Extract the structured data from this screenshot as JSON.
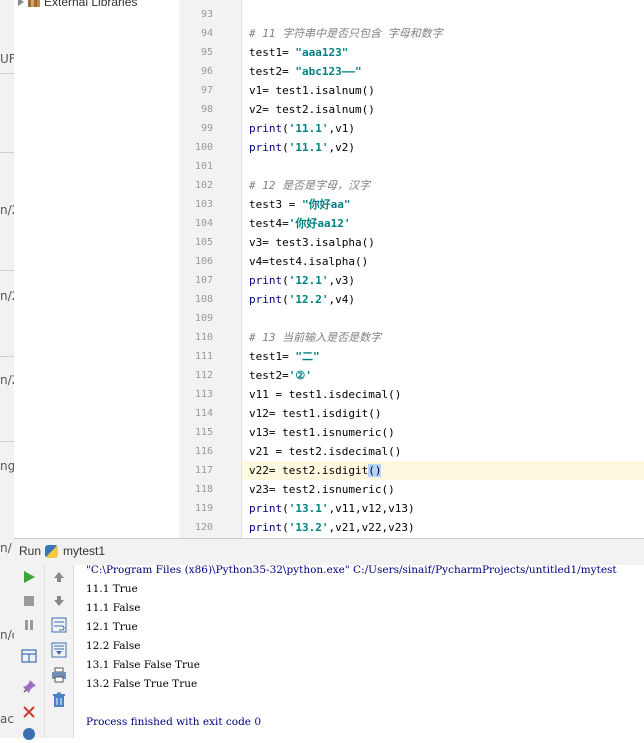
{
  "project": {
    "external_libraries_label": "External Libraries"
  },
  "left_strip": {
    "labels": [
      "UF",
      "n/2",
      "n/2",
      "n/2",
      "ng,",
      "n/",
      "n/c",
      "ac"
    ]
  },
  "editor": {
    "line_numbers": [
      "93",
      "94",
      "95",
      "96",
      "97",
      "98",
      "99",
      "100",
      "101",
      "102",
      "103",
      "104",
      "105",
      "106",
      "107",
      "108",
      "109",
      "110",
      "111",
      "112",
      "113",
      "114",
      "115",
      "116",
      "117",
      "118",
      "119",
      "120"
    ],
    "comments": {
      "c94": "# 11 字符串中是否只包含 字母和数字",
      "c102": "# 12 是否是字母，汉字",
      "c110": "# 13 当前输入是否是数字"
    },
    "code": {
      "l95a": "test1= ",
      "l95s": "\"aaa123\"",
      "l96a": "test2= ",
      "l96s": "\"abc123——\"",
      "l97": "v1= test1.isalnum()",
      "l98": "v2= test2.isalnum()",
      "l99k": "print",
      "l99a": "(",
      "l99s": "'11.1'",
      "l99b": ",v1)",
      "l100k": "print",
      "l100a": "(",
      "l100s": "'11.1'",
      "l100b": ",v2)",
      "l103a": "test3 = ",
      "l103s": "\"你好aa\"",
      "l104a": "test4=",
      "l104s": "'你好aa12'",
      "l105": "v3= test3.isalpha()",
      "l106": "v4=test4.isalpha()",
      "l107k": "print",
      "l107a": "(",
      "l107s": "'12.1'",
      "l107b": ",v3)",
      "l108k": "print",
      "l108a": "(",
      "l108s": "'12.2'",
      "l108b": ",v4)",
      "l111a": "test1= ",
      "l111s": "\"二\"",
      "l112a": "test2=",
      "l112s": "'②'",
      "l113": "v11 = test1.isdecimal()",
      "l114": "v12= test1.isdigit()",
      "l115": "v13= test1.isnumeric()",
      "l116": "v21 = test2.isdecimal()",
      "l117a": "v22= test2.isdigit",
      "l117b": "()",
      "l118": "v23= test2.isnumeric()",
      "l119k": "print",
      "l119a": "(",
      "l119s": "'13.1'",
      "l119b": ",v11,v12,v13)",
      "l120k": "print",
      "l120a": "(",
      "l120s": "'13.2'",
      "l120b": ",v21,v22,v23)"
    }
  },
  "run": {
    "tab_label": "Run",
    "config_name": "mytest1",
    "output": [
      "\"C:\\Program Files (x86)\\Python35-32\\python.exe\" C:/Users/sinaif/PycharmProjects/untitled1/mytest",
      "11.1 True",
      "11.1 False",
      "12.1 True",
      "12.2 False",
      "13.1 False False True",
      "13.2 False True True",
      "",
      "Process finished with exit code 0"
    ]
  },
  "colors": {
    "string": "#008080",
    "comment": "#808080",
    "keyword": "#000080",
    "current_line": "#fffadf"
  }
}
